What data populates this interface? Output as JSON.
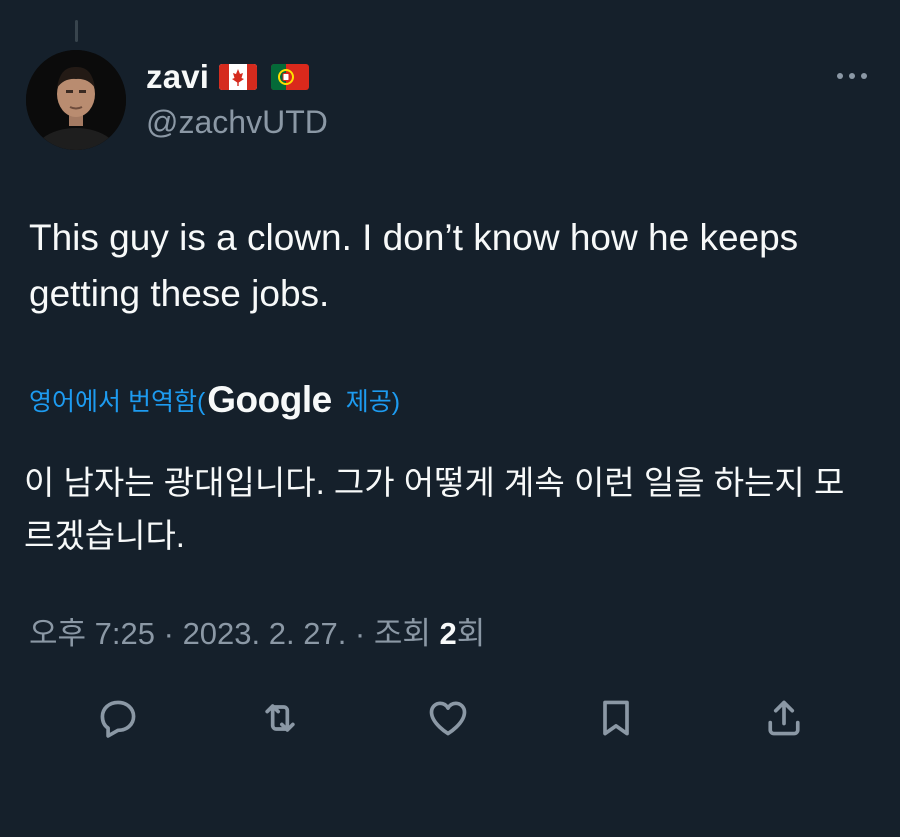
{
  "tweet": {
    "author": {
      "display_name": "zavi",
      "handle": "@zachvUTD",
      "flags": [
        "canada-flag",
        "portugal-flag"
      ]
    },
    "text": "This guy is a clown. I don’t know how he keeps getting these jobs.",
    "translation": {
      "label_before": "영어에서 번역함(",
      "google": "Google",
      "label_after": "제공)",
      "text": "이 남자는 광대입니다. 그가 어떻게 계속 이런 일을 하는지 모르겠습니다."
    },
    "meta": {
      "time": "오후 7:25",
      "separator": " · ",
      "date": "2023. 2. 27.",
      "views_prefix": "조회 ",
      "views_count": "2",
      "views_suffix": "회"
    }
  },
  "actions": [
    "reply-icon",
    "retweet-icon",
    "like-icon",
    "bookmark-icon",
    "share-icon"
  ],
  "colors": {
    "background": "#15202b",
    "text": "#e7e9ea",
    "secondary": "#8b98a5",
    "accent": "#1d9bf0"
  }
}
